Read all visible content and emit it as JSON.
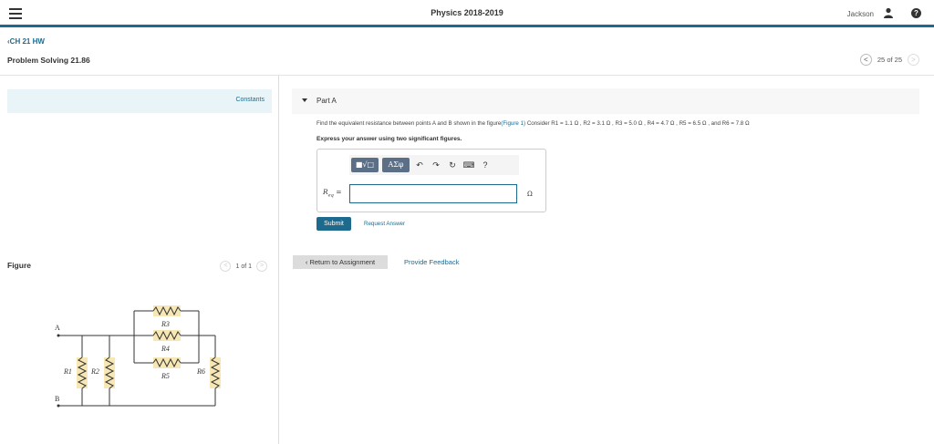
{
  "header": {
    "title": "Physics 2018-2019",
    "user_name": "Jackson",
    "help_symbol": "?"
  },
  "breadcrumb": "CH 21 HW",
  "problem_title": "Problem Solving 21.86",
  "pager": {
    "prev": "<",
    "text": "25 of 25",
    "next": ">"
  },
  "left": {
    "constants_label": "Constants",
    "figure_label": "Figure",
    "figure_pager": {
      "prev": "<",
      "text": "1 of 1",
      "next": ">"
    },
    "circuit_labels": {
      "a": "A",
      "b": "B",
      "r1": "R1",
      "r2": "R2",
      "r3": "R3",
      "r4": "R4",
      "r5": "R5",
      "r6": "R6"
    }
  },
  "part": {
    "title": "Part A",
    "question_prefix": "Find the equivalent resistance between points A and B shown in the figure",
    "figure_link": "(Figure 1)",
    "question_values": "Consider R1 = 1.1 Ω , R2 = 3.1 Ω , R3 = 5.0 Ω , R4 = 4.7 Ω , R5 = 6.5 Ω , and R6 = 7.8 Ω",
    "instruction": "Express your answer using two significant figures.",
    "toolbar": {
      "template_btn": "■√□",
      "greek_btn": "ΑΣφ",
      "undo": "↶",
      "redo": "↷",
      "reset": "↻",
      "keyboard": "⌨",
      "help": "?"
    },
    "eq_label": "R",
    "eq_sub": "eq",
    "eq_equals": " =",
    "answer_value": "",
    "unit": "Ω",
    "submit": "Submit",
    "request_answer": "Request Answer"
  },
  "footer": {
    "return": "Return to Assignment",
    "feedback": "Provide Feedback"
  }
}
